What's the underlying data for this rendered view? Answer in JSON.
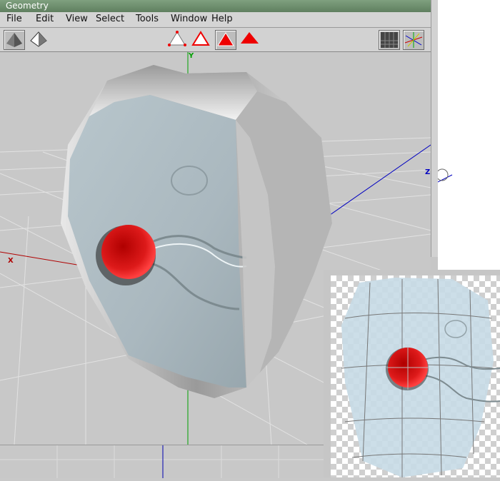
{
  "window": {
    "title": "Geometry"
  },
  "menu": [
    "File",
    "Edit",
    "View",
    "Select",
    "Tools",
    "Window",
    "Help"
  ],
  "viewport": {
    "axis_y": "Y",
    "axis_x": "X",
    "axis_z": "Z"
  },
  "colors": {
    "title_bar": "#6f8f6f",
    "marker_red": "#cc1111",
    "axis_x": "#b00000",
    "axis_y": "#00a000",
    "axis_z": "#0000c0"
  }
}
